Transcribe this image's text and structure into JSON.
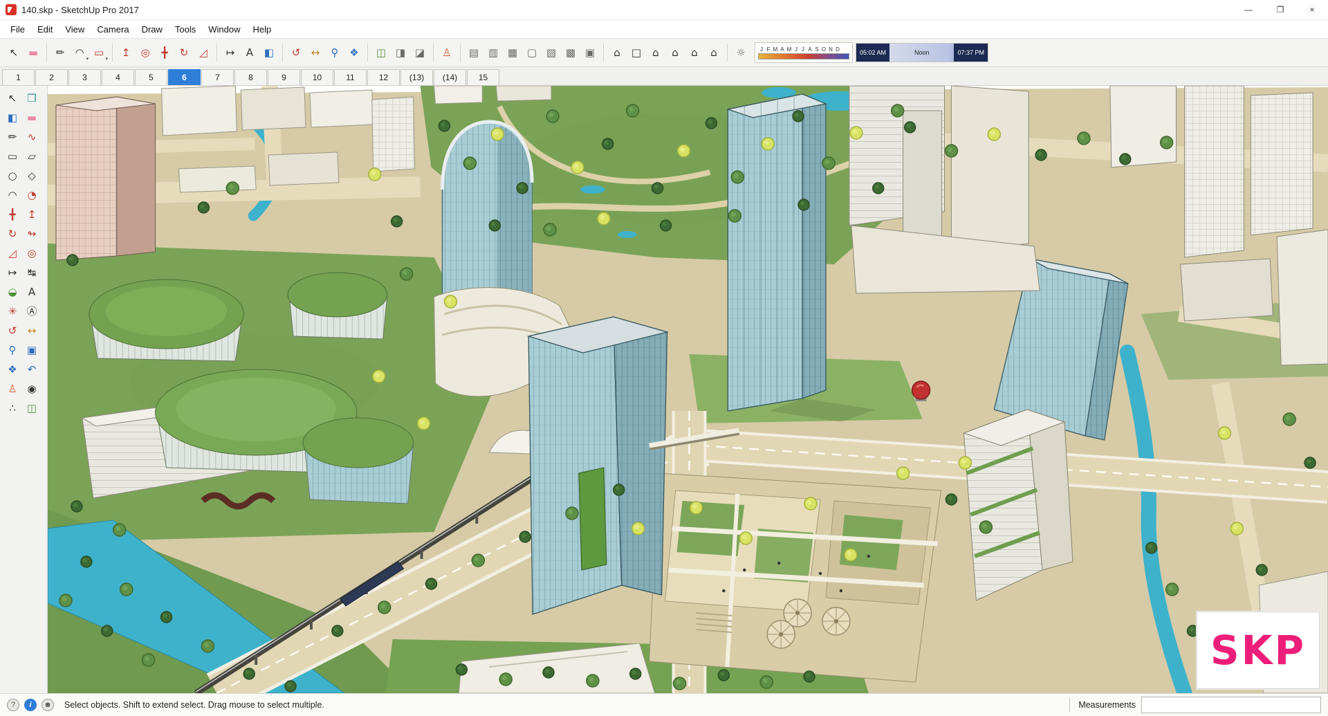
{
  "window": {
    "app_title": "140.skp - SketchUp Pro 2017",
    "controls": {
      "minimize": "—",
      "maximize": "❐",
      "close": "×"
    }
  },
  "menu": {
    "items": [
      {
        "name": "menu-file",
        "label": "File"
      },
      {
        "name": "menu-edit",
        "label": "Edit"
      },
      {
        "name": "menu-view",
        "label": "View"
      },
      {
        "name": "menu-camera",
        "label": "Camera"
      },
      {
        "name": "menu-draw",
        "label": "Draw"
      },
      {
        "name": "menu-tools",
        "label": "Tools"
      },
      {
        "name": "menu-window",
        "label": "Window"
      },
      {
        "name": "menu-help",
        "label": "Help"
      }
    ]
  },
  "toolbar": {
    "group_principal": [
      {
        "name": "select-tool-button",
        "icon": "select-icon",
        "glyph": "↖",
        "tone": "dark"
      },
      {
        "name": "eraser-tool-button",
        "icon": "eraser-icon",
        "glyph": "▬",
        "tone": "pink"
      }
    ],
    "group_draw": [
      {
        "name": "line-tool-button",
        "icon": "pencil-icon",
        "glyph": "✏",
        "tone": "dark"
      },
      {
        "name": "arc-tools-button",
        "icon": "arc-icon",
        "glyph": "◠",
        "tone": "dark",
        "caret": "▾"
      },
      {
        "name": "shape-tools-button",
        "icon": "rectangle-icon",
        "glyph": "▭",
        "tone": "red",
        "caret": "▾"
      }
    ],
    "group_edit": [
      {
        "name": "push-pull-tool-button",
        "icon": "push-pull-icon",
        "glyph": "↥",
        "tone": "red"
      },
      {
        "name": "offset-tool-button",
        "icon": "offset-icon",
        "glyph": "◎",
        "tone": "red"
      },
      {
        "name": "move-tool-button",
        "icon": "move-icon",
        "glyph": "╋",
        "tone": "red"
      },
      {
        "name": "rotate-tool-button",
        "icon": "rotate-icon",
        "glyph": "↻",
        "tone": "red"
      },
      {
        "name": "scale-tool-button",
        "icon": "scale-icon",
        "glyph": "◿",
        "tone": "red"
      }
    ],
    "group_construction": [
      {
        "name": "tape-measure-tool-button",
        "icon": "tape-measure-icon",
        "glyph": "↦",
        "tone": "dark"
      },
      {
        "name": "text-tool-button",
        "icon": "text-icon",
        "glyph": "A",
        "tone": "dark"
      },
      {
        "name": "paint-bucket-tool-button",
        "icon": "paint-bucket-icon",
        "glyph": "◧",
        "tone": "blue"
      }
    ],
    "group_camera": [
      {
        "name": "orbit-tool-button",
        "icon": "orbit-icon",
        "glyph": "↺",
        "tone": "red"
      },
      {
        "name": "pan-tool-button",
        "icon": "pan-icon",
        "glyph": "↔",
        "tone": "amber"
      },
      {
        "name": "zoom-tool-button",
        "icon": "magnifier-icon",
        "glyph": "⚲",
        "tone": "blue"
      },
      {
        "name": "zoom-extents-button",
        "icon": "zoom-extents-icon",
        "glyph": "❖",
        "tone": "blue"
      }
    ],
    "group_section": [
      {
        "name": "section-plane-button",
        "icon": "section-plane-icon",
        "glyph": "◫",
        "tone": "green"
      },
      {
        "name": "section-display-toggle-button",
        "icon": "section-display-icon",
        "glyph": "◨",
        "tone": "dim"
      },
      {
        "name": "section-cuts-toggle-button",
        "icon": "section-cut-icon",
        "glyph": "◪",
        "tone": "dim"
      }
    ],
    "group_position": [
      {
        "name": "position-camera-tool-button",
        "icon": "figure-icon",
        "glyph": "♙",
        "tone": "orange"
      }
    ],
    "group_styles": [
      {
        "name": "style-xray-button",
        "icon": "xray-cube-icon",
        "glyph": "▤",
        "tone": "dim"
      },
      {
        "name": "style-back-edges-button",
        "icon": "back-edges-cube-icon",
        "glyph": "▥",
        "tone": "dim"
      },
      {
        "name": "style-wireframe-button",
        "icon": "wireframe-cube-icon",
        "glyph": "▦",
        "tone": "dim"
      },
      {
        "name": "style-hidden-line-button",
        "icon": "hidden-line-cube-icon",
        "glyph": "▢",
        "tone": "dim"
      },
      {
        "name": "style-shaded-button",
        "icon": "shaded-cube-icon",
        "glyph": "▧",
        "tone": "dim"
      },
      {
        "name": "style-shaded-textures-button",
        "icon": "textured-cube-icon",
        "glyph": "▩",
        "tone": "dim"
      },
      {
        "name": "style-monochrome-button",
        "icon": "monochrome-cube-icon",
        "glyph": "▣",
        "tone": "dim"
      }
    ],
    "group_views": [
      {
        "name": "view-iso-button",
        "icon": "iso-house-icon",
        "glyph": "⌂",
        "tone": "dark"
      },
      {
        "name": "view-top-button",
        "icon": "top-house-icon",
        "glyph": "□",
        "tone": "dark"
      },
      {
        "name": "view-front-button",
        "icon": "front-house-icon",
        "glyph": "⌂",
        "tone": "dark"
      },
      {
        "name": "view-right-button",
        "icon": "right-house-icon",
        "glyph": "⌂",
        "tone": "dark"
      },
      {
        "name": "view-back-button",
        "icon": "back-house-icon",
        "glyph": "⌂",
        "tone": "dark"
      },
      {
        "name": "view-left-button",
        "icon": "left-house-icon",
        "glyph": "⌂",
        "tone": "dark"
      }
    ],
    "group_shadow": [
      {
        "name": "shadow-toggle-button",
        "icon": "sun-icon",
        "glyph": "☼",
        "tone": "dim"
      }
    ],
    "shadows": {
      "months": [
        "J",
        "F",
        "M",
        "A",
        "M",
        "J",
        "J",
        "A",
        "S",
        "O",
        "N",
        "D"
      ],
      "time_start": "05:02 AM",
      "noon_label": "Noon",
      "time_end": "07:37 PM"
    }
  },
  "scene_tabs": {
    "items": [
      {
        "name": "scene-tab-1",
        "label": "1"
      },
      {
        "name": "scene-tab-2",
        "label": "2"
      },
      {
        "name": "scene-tab-3",
        "label": "3"
      },
      {
        "name": "scene-tab-4",
        "label": "4"
      },
      {
        "name": "scene-tab-5",
        "label": "5"
      },
      {
        "name": "scene-tab-6",
        "label": "6",
        "state": "active"
      },
      {
        "name": "scene-tab-7",
        "label": "7"
      },
      {
        "name": "scene-tab-8",
        "label": "8"
      },
      {
        "name": "scene-tab-9",
        "label": "9"
      },
      {
        "name": "scene-tab-10",
        "label": "10"
      },
      {
        "name": "scene-tab-11",
        "label": "11"
      },
      {
        "name": "scene-tab-12",
        "label": "12"
      },
      {
        "name": "scene-tab-13",
        "label": "(13)"
      },
      {
        "name": "scene-tab-14",
        "label": "(14)"
      },
      {
        "name": "scene-tab-15",
        "label": "15"
      }
    ]
  },
  "left_toolbar": {
    "icons": [
      {
        "name": "select-tool-button",
        "icon": "select-icon",
        "glyph": "↖",
        "tone": "dark"
      },
      {
        "name": "make-component-button",
        "icon": "component-icon",
        "glyph": "❒",
        "tone": "teal"
      },
      {
        "name": "paint-bucket-tool-button",
        "icon": "paint-bucket-icon",
        "glyph": "◧",
        "tone": "blue"
      },
      {
        "name": "eraser-tool-button",
        "icon": "eraser-icon",
        "glyph": "▬",
        "tone": "pink"
      },
      {
        "name": "line-tool-button",
        "icon": "pencil-icon",
        "glyph": "✏",
        "tone": "dark"
      },
      {
        "name": "freehand-tool-button",
        "icon": "freehand-icon",
        "glyph": "∿",
        "tone": "red"
      },
      {
        "name": "rectangle-tool-button",
        "icon": "rectangle-icon",
        "glyph": "▭",
        "tone": "dark"
      },
      {
        "name": "rotated-rectangle-tool-button",
        "icon": "rotated-rectangle-icon",
        "glyph": "▱",
        "tone": "dark"
      },
      {
        "name": "circle-tool-button",
        "icon": "circle-icon",
        "glyph": "○",
        "tone": "dark"
      },
      {
        "name": "polygon-tool-button",
        "icon": "polygon-icon",
        "glyph": "◇",
        "tone": "dark"
      },
      {
        "name": "arc-tool-button",
        "icon": "arc-icon",
        "glyph": "◠",
        "tone": "dark"
      },
      {
        "name": "pie-tool-button",
        "icon": "pie-icon",
        "glyph": "◔",
        "tone": "red"
      },
      {
        "name": "move-tool-button",
        "icon": "move-icon",
        "glyph": "╋",
        "tone": "red"
      },
      {
        "name": "push-pull-tool-button",
        "icon": "push-pull-icon",
        "glyph": "↥",
        "tone": "red"
      },
      {
        "name": "rotate-tool-button",
        "icon": "rotate-icon",
        "glyph": "↻",
        "tone": "red"
      },
      {
        "name": "follow-me-tool-button",
        "icon": "follow-me-icon",
        "glyph": "↬",
        "tone": "red"
      },
      {
        "name": "scale-tool-button",
        "icon": "scale-icon",
        "glyph": "◿",
        "tone": "red"
      },
      {
        "name": "offset-tool-button",
        "icon": "offset-icon",
        "glyph": "◎",
        "tone": "red"
      },
      {
        "name": "tape-measure-tool-button",
        "icon": "tape-measure-icon",
        "glyph": "↦",
        "tone": "dark"
      },
      {
        "name": "dimension-tool-button",
        "icon": "dimension-icon",
        "glyph": "↹",
        "tone": "dark"
      },
      {
        "name": "protractor-tool-button",
        "icon": "protractor-icon",
        "glyph": "◒",
        "tone": "green"
      },
      {
        "name": "text-tool-button",
        "icon": "text-icon",
        "glyph": "A",
        "tone": "dark"
      },
      {
        "name": "axes-tool-button",
        "icon": "axes-icon",
        "glyph": "✳",
        "tone": "red"
      },
      {
        "name": "3d-text-tool-button",
        "icon": "3d-text-icon",
        "glyph": "Ⓐ",
        "tone": "dark"
      },
      {
        "name": "orbit-tool-button",
        "icon": "orbit-icon",
        "glyph": "↺",
        "tone": "red"
      },
      {
        "name": "pan-tool-button",
        "icon": "pan-icon",
        "glyph": "↔",
        "tone": "amber"
      },
      {
        "name": "zoom-tool-button",
        "icon": "magnifier-icon",
        "glyph": "⚲",
        "tone": "blue"
      },
      {
        "name": "zoom-window-tool-button",
        "icon": "zoom-window-icon",
        "glyph": "▣",
        "tone": "blue"
      },
      {
        "name": "zoom-extents-button",
        "icon": "zoom-extents-icon",
        "glyph": "❖",
        "tone": "blue"
      },
      {
        "name": "previous-view-button",
        "icon": "undo-view-icon",
        "glyph": "↶",
        "tone": "blue"
      },
      {
        "name": "position-camera-tool-button",
        "icon": "figure-icon",
        "glyph": "♙",
        "tone": "orange"
      },
      {
        "name": "look-around-tool-button",
        "icon": "eye-icon",
        "glyph": "◉",
        "tone": "dark"
      },
      {
        "name": "walk-tool-button",
        "icon": "footprints-icon",
        "glyph": "∴",
        "tone": "dark"
      },
      {
        "name": "section-plane-tool-button",
        "icon": "section-plane-icon",
        "glyph": "◫",
        "tone": "green"
      }
    ]
  },
  "statusbar": {
    "icons": [
      {
        "name": "geolocation-status-button",
        "icon": "geolocation-icon",
        "glyph": "?",
        "tone": "plain"
      },
      {
        "name": "help-info-button",
        "icon": "info-icon",
        "glyph": "i",
        "tone": "info"
      },
      {
        "name": "account-button",
        "icon": "person-icon",
        "glyph": "☻",
        "tone": "plain"
      }
    ],
    "message": "Select objects. Shift to extend select. Drag mouse to select multiple.",
    "measurements_label": "Measurements",
    "measurements_value": ""
  },
  "viewport": {
    "watermark": "SKP"
  },
  "colors": {
    "tab_active_blue": "#2f7ed8",
    "skp_logo_pink": "#ec1e79",
    "water_teal": "#3eb2cb",
    "grass_green": "#7ba357",
    "glass_blue": "#a9cdd5"
  }
}
